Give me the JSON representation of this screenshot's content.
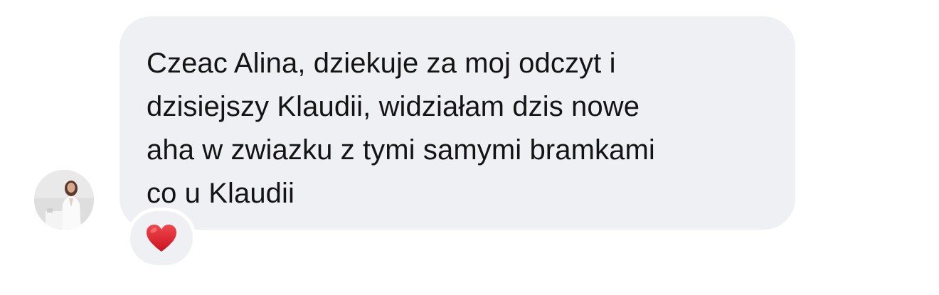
{
  "message": {
    "text": "Czeac Alina, dziekuje za moj odczyt i\ndzisiejszy Klaudii, widziałam dzis nowe\naha w zwiazku z tymi samymi bramkami\nco u Klaudii"
  },
  "reaction": {
    "icon": "red-heart-icon",
    "color": "#e3232e"
  },
  "colors": {
    "bubble": "#eef0f3",
    "text": "#141414",
    "background": "#ffffff"
  }
}
